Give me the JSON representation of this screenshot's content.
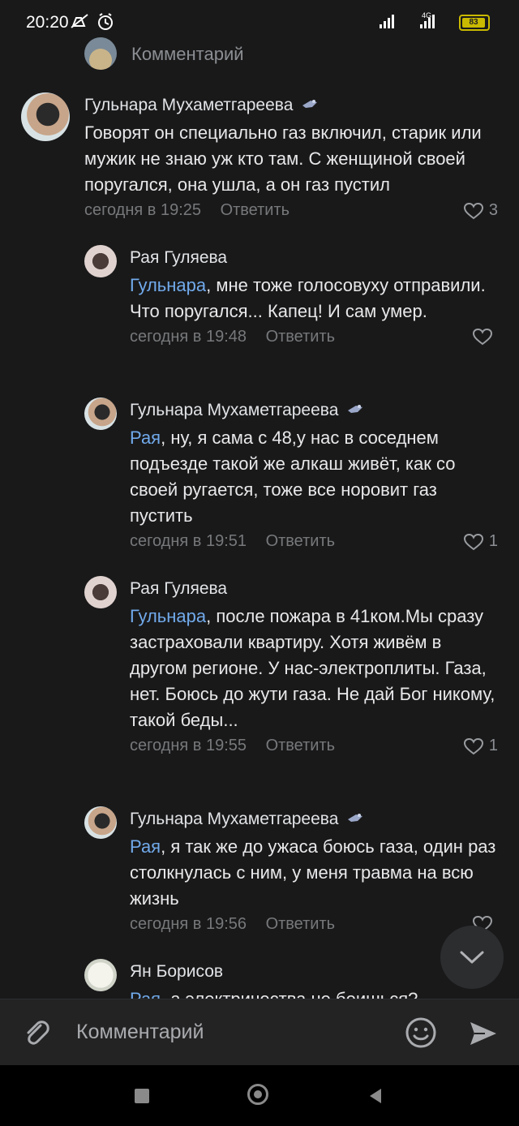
{
  "status_bar": {
    "time": "20:20",
    "network": "4G",
    "battery": "83"
  },
  "top_comment_field": {
    "placeholder": "Комментарий"
  },
  "comments": [
    {
      "author": "Гульнара Мухаметгареева",
      "mention": "",
      "text": "Говорят он специально газ включил, старик или мужик не знаю уж кто там. С женщиной своей поругался, она ушла, а он газ пустил",
      "time": "сегодня в 19:25",
      "reply_label": "Ответить",
      "likes": "3"
    },
    {
      "author": "Рая Гуляева",
      "mention": "Гульнара",
      "text": ", мне тоже голосовуху отправили. Что поругался... Капец! И сам умер.",
      "time": "сегодня в 19:48",
      "reply_label": "Ответить",
      "likes": ""
    },
    {
      "author": "Гульнара Мухаметгареева",
      "mention": "Рая",
      "text": ", ну, я сама с 48,у нас в соседнем подъезде такой же алкаш живёт, как со своей ругается, тоже все норовит газ пустить",
      "time": "сегодня в 19:51",
      "reply_label": "Ответить",
      "likes": "1"
    },
    {
      "author": "Рая Гуляева",
      "mention": "Гульнара",
      "text": ", после пожара в 41ком.Мы сразу застраховали квартиру. Хотя живём в другом регионе. У нас-электроплиты. Газа, нет. Боюсь до жути газа. Не дай Бог никому, такой беды...",
      "time": "сегодня в 19:55",
      "reply_label": "Ответить",
      "likes": "1"
    },
    {
      "author": "Гульнара Мухаметгареева",
      "mention": "Рая",
      "text": ", я так же до ужаса боюсь газа, один раз столкнулась с ним, у меня травма на всю жизнь",
      "time": "сегодня в 19:56",
      "reply_label": "Ответить",
      "likes": ""
    },
    {
      "author": "Ян Борисов",
      "mention": "Рая",
      "text": ", а электричества не боишься?",
      "time": "",
      "reply_label": "",
      "likes": ""
    }
  ],
  "composer": {
    "placeholder": "Комментарий"
  },
  "colors": {
    "background": "#19191a",
    "mention": "#71aaeb",
    "meta": "#76787a"
  },
  "icons": [
    "attach-icon",
    "emoji-icon",
    "send-icon",
    "heart-icon",
    "verified-icon",
    "chevron-down-icon"
  ]
}
